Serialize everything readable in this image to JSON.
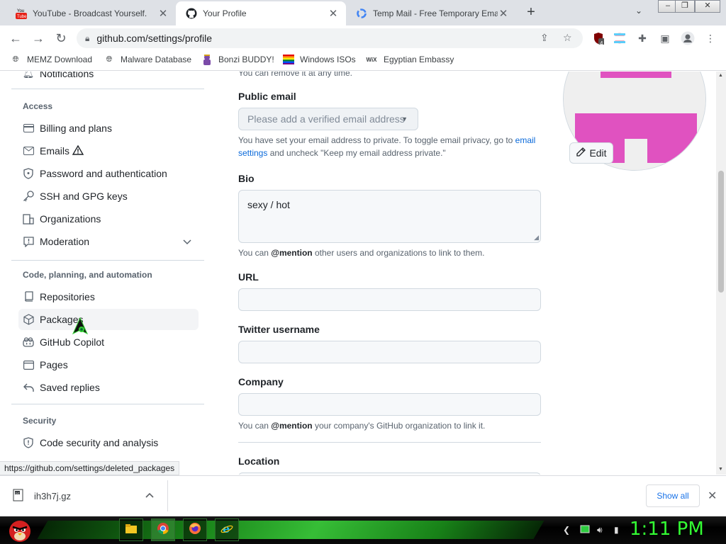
{
  "browser": {
    "tabs": [
      {
        "title": "YouTube - Broadcast Yourself.",
        "favicon": "youtube-icon",
        "active": false
      },
      {
        "title": "Your Profile",
        "favicon": "github-icon",
        "active": true
      },
      {
        "title": "Temp Mail - Free Temporary Email",
        "favicon": "google-icon",
        "active": false
      }
    ],
    "url": "github.com/settings/profile",
    "extension_badge": "4",
    "bookmarks": [
      {
        "label": "MEMZ Download",
        "icon": "globe-icon"
      },
      {
        "label": "Malware Database",
        "icon": "globe-icon"
      },
      {
        "label": "Bonzi BUDDY!",
        "icon": "bonzi-icon"
      },
      {
        "label": "Windows ISOs",
        "icon": "rainbow-flag-icon"
      },
      {
        "label": "Egyptian Embassy",
        "icon": "wix-icon"
      }
    ]
  },
  "sidebar": {
    "top_item": "Notifications",
    "sections": [
      {
        "heading": "Access",
        "items": [
          "Billing and plans",
          "Emails",
          "Password and authentication",
          "SSH and GPG keys",
          "Organizations",
          "Moderation"
        ]
      },
      {
        "heading": "Code, planning, and automation",
        "items": [
          "Repositories",
          "Packages",
          "GitHub Copilot",
          "Pages",
          "Saved replies"
        ]
      },
      {
        "heading": "Security",
        "items": [
          "Code security and analysis"
        ]
      }
    ]
  },
  "form": {
    "top_note": "You can remove it at any time.",
    "public_email": {
      "label": "Public email",
      "placeholder": "Please add a verified email address",
      "note_before": "You have set your email address to private. To toggle email privacy, go to ",
      "note_link": "email settings",
      "note_after": " and uncheck \"Keep my email address private.\""
    },
    "bio": {
      "label": "Bio",
      "value": "sexy / hot",
      "note_before": "You can ",
      "note_bold": "@mention",
      "note_after": " other users and organizations to link to them."
    },
    "url": {
      "label": "URL",
      "value": ""
    },
    "twitter": {
      "label": "Twitter username",
      "value": ""
    },
    "company": {
      "label": "Company",
      "value": "",
      "note_before": "You can ",
      "note_bold": "@mention",
      "note_after": " your company's GitHub organization to link it."
    },
    "location": {
      "label": "Location"
    },
    "edit_button": "Edit"
  },
  "status_url": "https://github.com/settings/deleted_packages",
  "downloads": {
    "file": "ih3h7j.gz",
    "show_all": "Show all"
  },
  "taskbar": {
    "clock": "1:11 PM"
  },
  "colors": {
    "link": "#0969da",
    "avatar_pink": "#e052c0",
    "clock_green": "#33ff33"
  }
}
